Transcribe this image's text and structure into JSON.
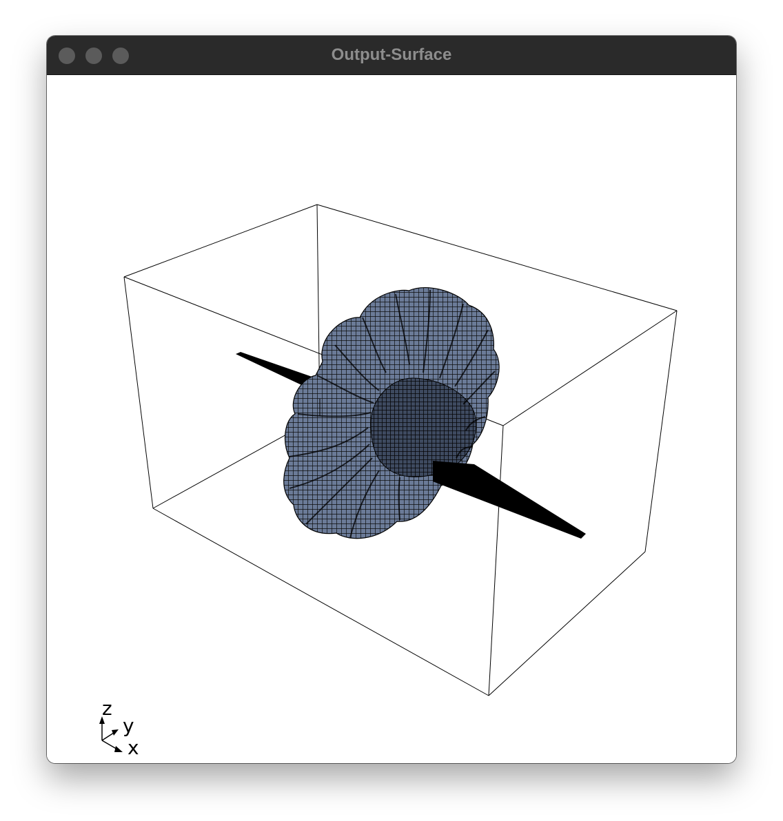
{
  "window": {
    "title": "Output-Surface"
  },
  "controls": {
    "close": "close-button",
    "minimize": "minimize-button",
    "maximize": "maximize-button"
  },
  "axes_indicator": {
    "z_label": "z",
    "y_label": "y",
    "x_label": "x"
  },
  "colors": {
    "titlebar": "#2a2a2a",
    "title_text": "#8d8d8d",
    "surface_fill": "#5a6a86",
    "mesh": "#0b0b0b",
    "bounding_box": "#000000"
  },
  "icons": [
    "close-icon",
    "minimize-icon",
    "maximize-icon",
    "axis-triad-icon"
  ]
}
